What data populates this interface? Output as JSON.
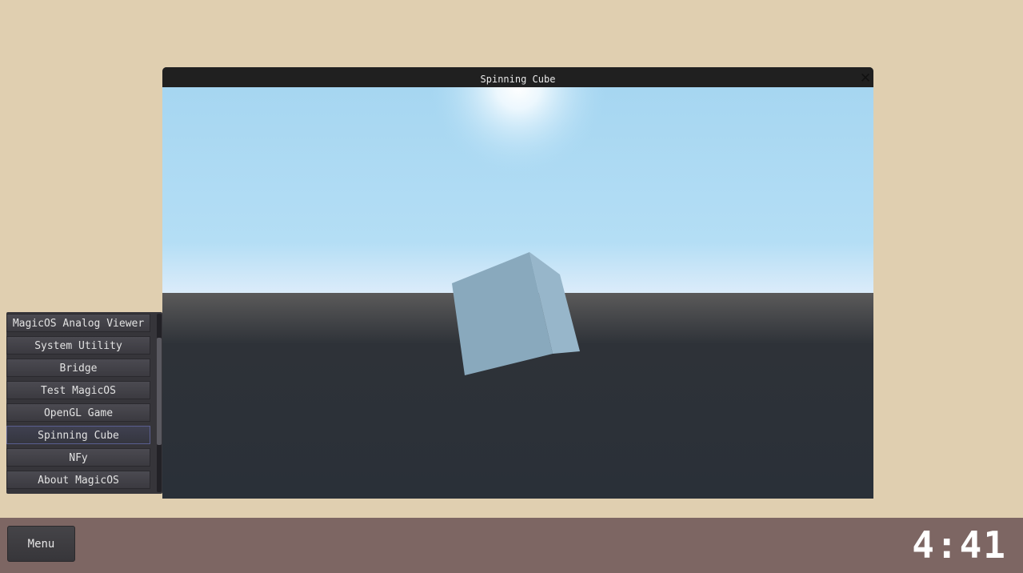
{
  "window": {
    "title": "Spinning Cube",
    "close_icon": "close-icon"
  },
  "scene": {
    "sky_top": "#a6d6f1",
    "sky_horizon": "#dcecfa",
    "ground_top": "#5a5a5a",
    "ground": "#2a3038",
    "cube_front": "#89a9bd",
    "cube_side": "#97b6ca"
  },
  "app_menu": {
    "items": [
      {
        "label": "MagicOS Analog Viewer"
      },
      {
        "label": "System Utility"
      },
      {
        "label": "Bridge"
      },
      {
        "label": "Test MagicOS"
      },
      {
        "label": "OpenGL Game"
      },
      {
        "label": "Spinning Cube"
      },
      {
        "label": "NFy"
      },
      {
        "label": "About MagicOS"
      }
    ],
    "selected": "Spinning Cube"
  },
  "taskbar": {
    "menu_label": "Menu",
    "clock": "4:41"
  },
  "colors": {
    "desktop": "#e0cfb0",
    "taskbar": "#7d6663",
    "selection_border": "#5a5f90"
  }
}
